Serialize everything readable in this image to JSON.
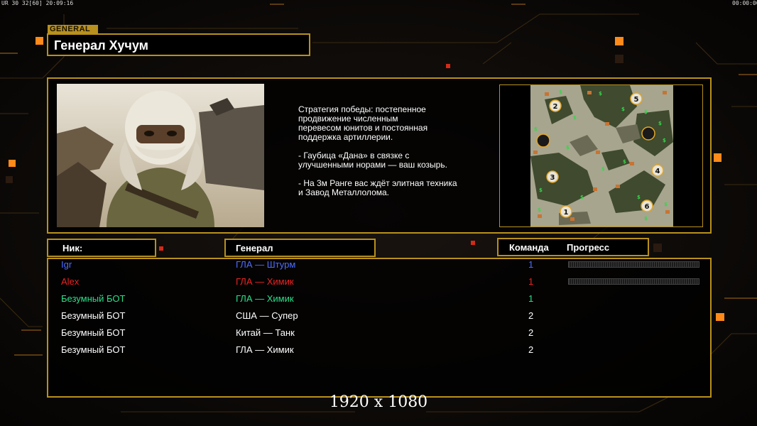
{
  "hud": {
    "top_left": "UR 30 32[60] 20:09:16",
    "top_right": "00:00:00"
  },
  "colors": {
    "gold": "#b8901d",
    "orange": "#ff8a1a",
    "blue": "#4d6cff",
    "red": "#ee2222",
    "green": "#2be08a",
    "white": "#ffffff"
  },
  "header": {
    "tab_label": "GENERAL",
    "title": "Генерал Хучум"
  },
  "info": {
    "portrait_icon": "general-portrait-image",
    "description": [
      "Стратегия победы: постепенное",
      "продвижение численным",
      "перевесом юнитов и постоянная",
      "поддержка артиллерии.",
      "",
      "- Гаубица «Дана» в связке с",
      "улучшенными норами — ваш козырь.",
      "",
      "- На 3м Ранге вас ждёт элитная техника",
      "и Завод Металлолома."
    ],
    "minimap": {
      "icon": "minimap-image",
      "start_positions": [
        "1",
        "2",
        "3",
        "4",
        "5",
        "6"
      ]
    }
  },
  "table": {
    "headers": {
      "nick": "Ник:",
      "general": "Генерал",
      "team": "Команда",
      "progress": "Прогресс"
    },
    "rows": [
      {
        "nick": "Igr",
        "general": "ГЛА — Штурм",
        "team": "1",
        "color": "#4d6cff",
        "progress": true
      },
      {
        "nick": "Alex",
        "general": "ГЛА — Химик",
        "team": "1",
        "color": "#ee2222",
        "progress": true
      },
      {
        "nick": "Безумный БОТ",
        "general": "ГЛА — Химик",
        "team": "1",
        "color": "#2be08a",
        "progress": false
      },
      {
        "nick": "Безумный БОТ",
        "general": "США — Супер",
        "team": "2",
        "color": "#ffffff",
        "progress": false
      },
      {
        "nick": "Безумный БОТ",
        "general": "Китай — Танк",
        "team": "2",
        "color": "#ffffff",
        "progress": false
      },
      {
        "nick": "Безумный БОТ",
        "general": "ГЛА — Химик",
        "team": "2",
        "color": "#ffffff",
        "progress": false
      }
    ]
  },
  "footer": {
    "resolution": "1920 x 1080"
  }
}
